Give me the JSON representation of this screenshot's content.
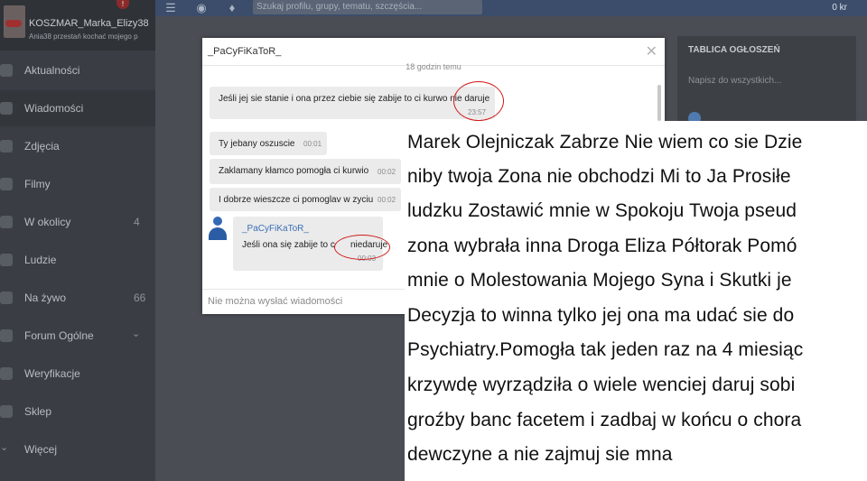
{
  "profile": {
    "name": "KOSZMAR_Marka_Elizy38",
    "status": "Ania38 przestań kochać mojego p",
    "alert": "!"
  },
  "sidebar": {
    "items": [
      {
        "label": "Aktualności",
        "count": ""
      },
      {
        "label": "Wiadomości",
        "count": ""
      },
      {
        "label": "Zdjęcia",
        "count": ""
      },
      {
        "label": "Filmy",
        "count": ""
      },
      {
        "label": "W okolicy",
        "count": "4"
      },
      {
        "label": "Ludzie",
        "count": ""
      },
      {
        "label": "Na żywo",
        "count": "66"
      },
      {
        "label": "Forum Ogólne",
        "count": ""
      },
      {
        "label": "Weryfikacje",
        "count": ""
      },
      {
        "label": "Sklep",
        "count": ""
      },
      {
        "label": "Więcej",
        "count": ""
      }
    ]
  },
  "topbar": {
    "search_placeholder": "Szukaj profilu, grupy, tematu, szczęścia...",
    "money": "0 kr"
  },
  "board": {
    "title": "TABLICA OGŁOSZEŃ",
    "input_placeholder": "Napisz do wszystkich..."
  },
  "chat": {
    "title": "_PaCyFiKaToR_",
    "time_ago": "18 godzin temu",
    "messages": [
      {
        "text": "Jeśli jej sie stanie i ona przez ciebie się zabije to ci kurwo nie daruje",
        "time": "23:57"
      },
      {
        "text": "Ty jebany oszuscie",
        "time": "00:01"
      },
      {
        "text": "Zaklamany kłamco pomogła ci kurwio",
        "time": "00:02"
      },
      {
        "text": "I dobrze wieszcze ci pomoglav w zyciu",
        "time": "00:02"
      }
    ],
    "reply": {
      "sender": "_PaCyFiKaToR_",
      "text_before": "Jeśli ona się zabije to c",
      "text_circled": "niedaruje",
      "time": "00:03"
    },
    "footer": "Nie można wysłać wiadomości"
  },
  "overlay": {
    "lines": [
      "Marek Olejniczak Zabrze Nie wiem co sie Dzie",
      "niby twoja Zona nie obchodzi Mi to Ja Prosiłe",
      "ludzku Zostawić mnie w Spokoju Twoja pseud",
      "zona wybrała inna Droga Eliza Półtorak Pomó",
      "mnie o Molestowania Mojego Syna i Skutki je",
      "Decyzja to winna tylko jej ona ma udać sie do",
      "Psychiatry.Pomogła tak jeden raz na 4 miesiąc",
      "krzywdę wyrządziła o wiele wenciej daruj sobi",
      "groźby banc facetem i zadbaj w końcu o chora",
      "dewczyne a nie zajmuj sie mna"
    ]
  },
  "colors": {
    "annotation": "#d01a1a",
    "topbar": "#3b4d6a",
    "avatar_blue": "#3469b5"
  }
}
